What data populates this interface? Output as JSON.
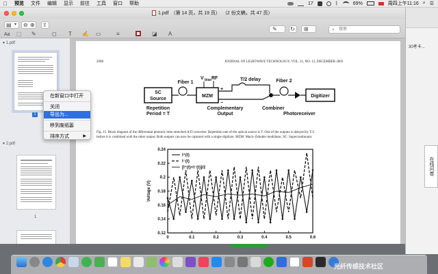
{
  "menubar": {
    "app_name": "预览",
    "menus": [
      "文件",
      "编辑",
      "显示",
      "前往",
      "工具",
      "窗口",
      "帮助"
    ],
    "status_count": "17",
    "battery": "69%",
    "clock": "周四上午11:16"
  },
  "window": {
    "filename": "1.pdf",
    "page_info": "（第 14 页，共 19 页）",
    "doc_info": "（2 份文稿，共 47 页）",
    "search_placeholder": "搜索"
  },
  "sidebar": {
    "doc1_name": "1.pdf",
    "doc1_page_badge": "1",
    "doc2_name": "2.pdf",
    "doc2_page_num": "1"
  },
  "context_menu": {
    "items": [
      "在新窗口中打开",
      "关闭",
      "导出为...",
      "移到废纸篓",
      "排序方式"
    ]
  },
  "page": {
    "running_head_page": "2098",
    "running_head_journal": "JOURNAL OF LIGHTWAVE TECHNOLOGY, VOL. 21, NO. 12, DECEMBER 2003",
    "diagram": {
      "sc_source_line1": "SC",
      "sc_source_line2": "Source",
      "repetition_line1": "Repetition",
      "repetition_line2": "Period = T",
      "fiber1": "Fiber 1",
      "vbias": "V",
      "vbias_sub": "bias",
      "rf": "RF",
      "mzm": "MZM",
      "delay": "T/2 delay",
      "fiber2": "Fiber 2",
      "digitizer": "Digitizer",
      "complementary_line1": "Complementary",
      "complementary_line2": "Output",
      "combiner": "Combiner",
      "photoreceiver": "Photoreceiver",
      "plus": "+",
      "minus": "−"
    },
    "caption_line1": "Fig. 15.    Block diagram of the differential photonic time-stretched A/D converter. Repetition rate of the optical source is T. One of the outputs is delayed by T/2",
    "caption_line2": "before it is combined with the other output. Both outputs can now be captured with a single digitizer. MZM: Mach–Zehnder modulator, SC: Supercontinuum."
  },
  "side_tab_label": "在线问卷",
  "right_window_text": "30考卡...",
  "watermark": "光纤传感技术社区",
  "chart_data": {
    "type": "line",
    "title": "",
    "xlabel": "",
    "ylabel": "Voltage (V)",
    "xlim": [
      0,
      0.6
    ],
    "ylim": [
      0.12,
      0.24
    ],
    "x_ticks": [
      "0",
      "0.1",
      "0.2",
      "0.3",
      "0.4",
      "0.5",
      "0.6"
    ],
    "y_ticks": [
      "0.12",
      "0.14",
      "0.16",
      "0.18",
      "0.2",
      "0.22",
      "0.24"
    ],
    "legend": [
      "I⁺(t)",
      "I⁻(t)",
      "[I⁺(t)+I⁻(t)]/2"
    ],
    "legend_position": "top-left",
    "series": [
      {
        "name": "I⁺(t)",
        "x": [
          0,
          0.025,
          0.05,
          0.075,
          0.1,
          0.125,
          0.15,
          0.175,
          0.2,
          0.225,
          0.25,
          0.275,
          0.3,
          0.325,
          0.35,
          0.375,
          0.4,
          0.425,
          0.45,
          0.475,
          0.5,
          0.525,
          0.55,
          0.575,
          0.6
        ],
        "values": [
          0.17,
          0.14,
          0.2,
          0.15,
          0.195,
          0.14,
          0.2,
          0.14,
          0.2,
          0.14,
          0.21,
          0.14,
          0.2,
          0.135,
          0.21,
          0.135,
          0.2,
          0.135,
          0.21,
          0.14,
          0.21,
          0.14,
          0.2,
          0.15,
          0.21
        ]
      },
      {
        "name": "I⁻(t)",
        "x": [
          0,
          0.025,
          0.05,
          0.075,
          0.1,
          0.125,
          0.15,
          0.175,
          0.2,
          0.225,
          0.25,
          0.275,
          0.3,
          0.325,
          0.35,
          0.375,
          0.4,
          0.425,
          0.45,
          0.475,
          0.5,
          0.525,
          0.55,
          0.575,
          0.6
        ],
        "values": [
          0.15,
          0.2,
          0.145,
          0.21,
          0.14,
          0.21,
          0.14,
          0.21,
          0.145,
          0.21,
          0.14,
          0.215,
          0.14,
          0.215,
          0.14,
          0.215,
          0.14,
          0.21,
          0.15,
          0.2,
          0.15,
          0.21,
          0.17,
          0.235,
          0.17
        ]
      },
      {
        "name": "[I⁺(t)+I⁻(t)]/2",
        "x": [
          0,
          0.05,
          0.1,
          0.15,
          0.2,
          0.25,
          0.3,
          0.35,
          0.4,
          0.45,
          0.5,
          0.55,
          0.6
        ],
        "values": [
          0.16,
          0.172,
          0.168,
          0.175,
          0.172,
          0.176,
          0.174,
          0.176,
          0.173,
          0.18,
          0.178,
          0.185,
          0.19
        ]
      }
    ]
  }
}
